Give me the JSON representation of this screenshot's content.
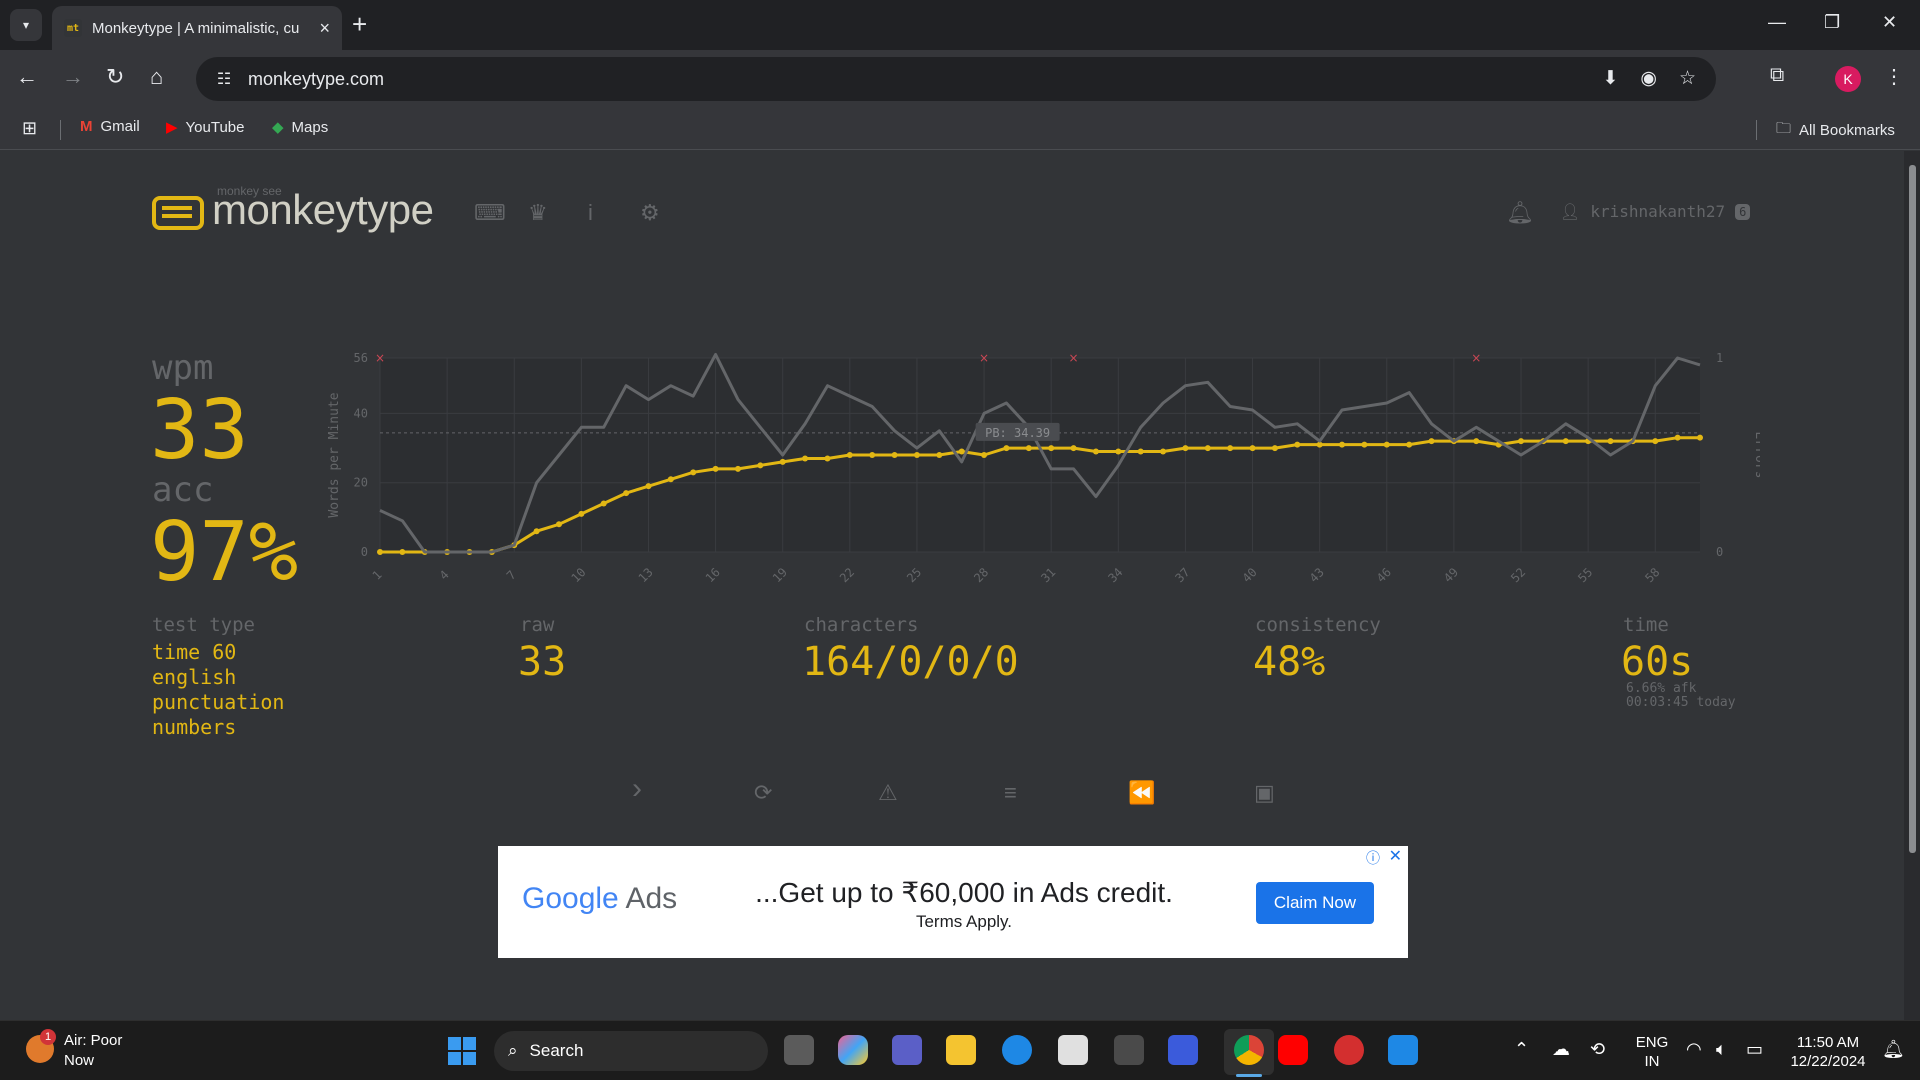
{
  "browser": {
    "tab_title": "Monkeytype | A minimalistic, cu",
    "tab_favicon": "mt",
    "url": "monkeytype.com",
    "bookmarks": [
      {
        "label": "Gmail",
        "icon": "gmail-icon",
        "color": "#ea4335"
      },
      {
        "label": "YouTube",
        "icon": "youtube-icon",
        "color": "#ff0000"
      },
      {
        "label": "Maps",
        "icon": "maps-icon",
        "color": "#34a853"
      }
    ],
    "all_bookmarks_label": "All Bookmarks",
    "profile_initial": "K"
  },
  "site": {
    "logo_small": "monkey see",
    "logo_text": "monkeytype",
    "username": "krishnakanth27",
    "level": "6"
  },
  "result": {
    "wpm_label": "wpm",
    "wpm": "33",
    "acc_label": "acc",
    "acc": "97%",
    "test_type_label": "test type",
    "test_type_lines": [
      "time 60",
      "english",
      "punctuation",
      "numbers"
    ],
    "raw_label": "raw",
    "raw": "33",
    "characters_label": "characters",
    "characters": "164/0/0/0",
    "consistency_label": "consistency",
    "consistency": "48%",
    "time_label": "time",
    "time": "60s",
    "afk_note": "6.66% afk",
    "today_note": "00:03:45 today"
  },
  "chart_data": {
    "type": "line",
    "ylabel": "Words per Minute",
    "y2label": "Errors",
    "ylim": [
      0,
      56
    ],
    "yticks": [
      0,
      20,
      40,
      56
    ],
    "y2ticks": [
      0,
      1
    ],
    "x": [
      1,
      2,
      3,
      4,
      5,
      6,
      7,
      8,
      9,
      10,
      11,
      12,
      13,
      14,
      15,
      16,
      17,
      18,
      19,
      20,
      21,
      22,
      23,
      24,
      25,
      26,
      27,
      28,
      29,
      30,
      31,
      32,
      33,
      34,
      35,
      36,
      37,
      38,
      39,
      40,
      41,
      42,
      43,
      44,
      45,
      46,
      47,
      48,
      49,
      50,
      51,
      52,
      53,
      54,
      55,
      56,
      57,
      58,
      59,
      60
    ],
    "xticks": [
      1,
      4,
      7,
      10,
      13,
      16,
      19,
      22,
      25,
      28,
      31,
      34,
      37,
      40,
      43,
      46,
      49,
      52,
      55,
      58
    ],
    "pb_label": "PB: 34.39",
    "pb_value": 34.39,
    "series": [
      {
        "name": "wpm",
        "color": "#e2b714",
        "values": [
          0,
          0,
          0,
          0,
          0,
          0,
          2,
          6,
          8,
          11,
          14,
          17,
          19,
          21,
          23,
          24,
          24,
          25,
          26,
          27,
          27,
          28,
          28,
          28,
          28,
          28,
          29,
          28,
          30,
          30,
          30,
          30,
          29,
          29,
          29,
          29,
          30,
          30,
          30,
          30,
          30,
          31,
          31,
          31,
          31,
          31,
          31,
          32,
          32,
          32,
          31,
          32,
          32,
          32,
          32,
          32,
          32,
          32,
          33,
          33
        ]
      },
      {
        "name": "raw",
        "color": "#646669",
        "values": [
          12,
          9,
          0,
          0,
          0,
          0,
          2,
          20,
          28,
          36,
          36,
          48,
          44,
          48,
          45,
          57,
          44,
          36,
          28,
          37,
          48,
          45,
          42,
          35,
          30,
          35,
          26,
          40,
          43,
          36,
          24,
          24,
          16,
          25,
          36,
          43,
          48,
          49,
          42,
          41,
          36,
          37,
          32,
          41,
          42,
          43,
          46,
          37,
          32,
          36,
          32,
          28,
          32,
          37,
          33,
          28,
          32,
          48,
          56,
          54
        ]
      }
    ],
    "errors_x": [
      1,
      28,
      32,
      50
    ]
  },
  "actions": [
    {
      "name": "next-test-button",
      "glyph": "›"
    },
    {
      "name": "restart-button",
      "glyph": "⟳"
    },
    {
      "name": "practice-words-button",
      "glyph": "⚠"
    },
    {
      "name": "show-words-history-button",
      "glyph": "≡"
    },
    {
      "name": "watch-replay-button",
      "glyph": "⏪"
    },
    {
      "name": "save-screenshot-button",
      "glyph": "▣"
    }
  ],
  "ad": {
    "brand": "Google",
    "product": "Ads",
    "headline": "...Get up to ₹60,000 in Ads credit.",
    "subline": "Terms Apply.",
    "cta": "Claim Now"
  },
  "taskbar": {
    "weather_title": "Air: Poor",
    "weather_sub": "Now",
    "weather_badge": "1",
    "search_label": "Search",
    "lang_line1": "ENG",
    "lang_line2": "IN",
    "time": "11:50 AM",
    "date": "12/22/2024"
  }
}
